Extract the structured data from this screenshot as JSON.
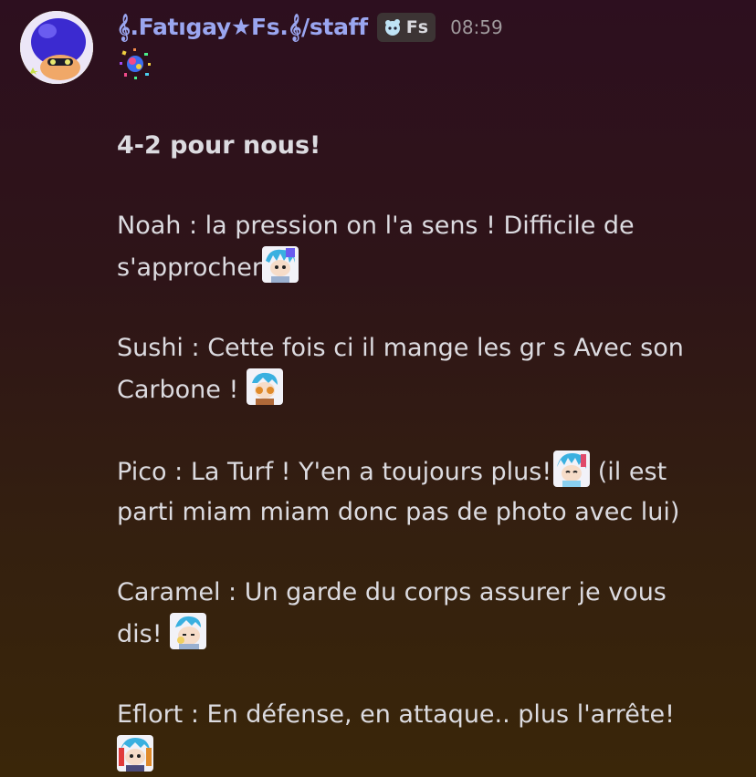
{
  "message": {
    "author": "𝄞.Fatıgay★Fs.𝄞/staff",
    "tag_label": "Fs",
    "timestamp": "08:59",
    "lines": {
      "headline": "4-2 pour nous!",
      "noah_1": "Noah : la pression on l'a sens ! Difficile de",
      "noah_2": "s'approcher",
      "sushi_1": "Sushi : Cette fois ci il mange les gr s Avec son",
      "sushi_2": "Carbone ! ",
      "pico_1a": "Pico : La Turf ! Y'en a toujours plus!",
      "pico_1b": " (il est",
      "pico_2": "parti miam miam donc pas de photo avec lui)",
      "caramel_1": " Caramel : Un garde du corps assurer je vous",
      "caramel_2": "dis! ",
      "eflort_1": "Eflort : En défense, en attaque.. plus l'arrête!"
    }
  },
  "icons": {
    "avatar": "squid-avatar",
    "tag": "splat-tag-icon",
    "confetti": "confetti-emoji",
    "player_emojis": [
      "noah-emoji",
      "sushi-emoji",
      "pico-emoji",
      "caramel-emoji",
      "eflort-emoji"
    ]
  },
  "colors": {
    "username": "#9aa6f0",
    "text": "#dcdbe0",
    "timestamp": "#a09a9d",
    "tag_bg": "#3c3434"
  }
}
